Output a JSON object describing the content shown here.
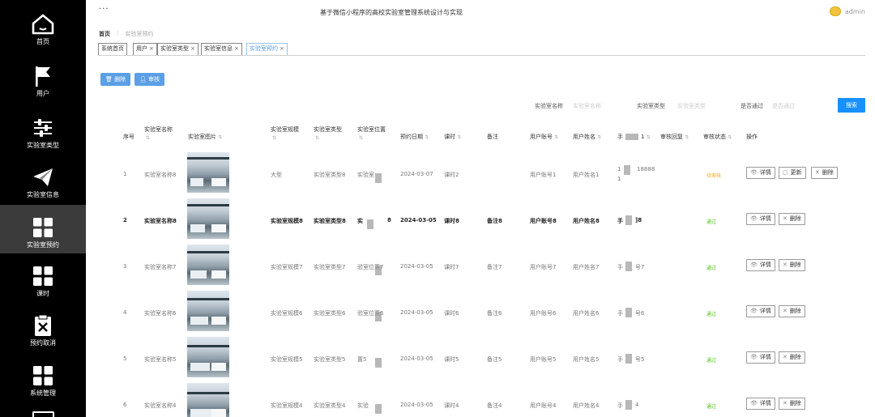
{
  "app": {
    "title": "基于微信小程序的高校实验室管理系统设计与实现",
    "more": "···",
    "user": "admin"
  },
  "sidebar": {
    "items": [
      {
        "label": "首页",
        "icon": "home-icon"
      },
      {
        "label": "用户",
        "icon": "flag-icon"
      },
      {
        "label": "实验室类型",
        "icon": "sliders-icon"
      },
      {
        "label": "实验室信息",
        "icon": "paper-plane-icon"
      },
      {
        "label": "实验室预约",
        "icon": "grid-icon"
      },
      {
        "label": "课时",
        "icon": "grid-icon"
      },
      {
        "label": "预约取消",
        "icon": "clipboard-x-icon"
      },
      {
        "label": "系统管理",
        "icon": "grid-icon"
      }
    ],
    "active_index": 4
  },
  "breadcrumb": {
    "home": "首页",
    "current": "实验室预约"
  },
  "tabs": [
    {
      "label": "系统首页",
      "closable": false
    },
    {
      "label": "用户",
      "closable": true
    },
    {
      "label": "实验室类型",
      "closable": true
    },
    {
      "label": "实验室信息",
      "closable": true
    },
    {
      "label": "实验室预约",
      "closable": true
    }
  ],
  "actions": {
    "delete": "删除",
    "review": "审核"
  },
  "search": {
    "name_label": "实验室名称",
    "name_placeholder": "实验室名称",
    "type_label": "实验室类型",
    "type_placeholder": "实验室类型",
    "pass_label": "是否通过",
    "pass_placeholder": "是否通过",
    "button": "搜索"
  },
  "columns": {
    "index": "序号",
    "name": "实验室名称",
    "image": "实验室图片",
    "scale": "实验室规模",
    "type": "实验室类型",
    "location": "实验室位置",
    "date": "预约日期",
    "lesson": "课时",
    "remark": "备注",
    "account": "用户账号",
    "username": "用户姓名",
    "phone_prefix": "手",
    "phone_suffix": "1",
    "reply": "审核回复",
    "status": "审核状态",
    "ops": "操作"
  },
  "rows": [
    {
      "index": "1",
      "name": "实验室名称8",
      "scale": "大型",
      "type": "实验室类型8",
      "location": "实验室",
      "date": "2024-03-07",
      "lesson": "课时2",
      "remark": "",
      "account": "用户账号1",
      "username": "用户姓名1",
      "phone_a": "1",
      "phone_b": "18888",
      "phone_c": "1",
      "status": "待审核",
      "status_color": "#f5a623",
      "bold": false,
      "can_update": true
    },
    {
      "index": "2",
      "name": "实验室名称8",
      "scale": "实验室规模8",
      "type": "实验室类型8",
      "location": "实",
      "location_b": "8",
      "date": "2024-03-05",
      "lesson": "课时8",
      "remark": "备注8",
      "account": "用户账号8",
      "username": "用户姓名8",
      "phone_a": "手",
      "phone_b": "]8",
      "status": "通过",
      "status_color": "#52c41a",
      "bold": true,
      "can_update": false
    },
    {
      "index": "3",
      "name": "实验室名称7",
      "scale": "实验室规模7",
      "type": "实验室类型7",
      "location": "验室位置7",
      "date": "2024-03-05",
      "lesson": "课时7",
      "remark": "备注7",
      "account": "用户账号7",
      "username": "用户姓名7",
      "phone_a": "手",
      "phone_b": "号7",
      "status": "通过",
      "status_color": "#52c41a",
      "bold": false,
      "can_update": false
    },
    {
      "index": "4",
      "name": "实验室名称6",
      "scale": "实验室规模6",
      "type": "实验室类型6",
      "location": "验室位置6",
      "date": "2024-03-05",
      "lesson": "课时6",
      "remark": "备注6",
      "account": "用户账号6",
      "username": "用户姓名6",
      "phone_a": "手",
      "phone_b": "号6",
      "status": "通过",
      "status_color": "#52c41a",
      "bold": false,
      "can_update": false
    },
    {
      "index": "5",
      "name": "实验室名称5",
      "scale": "实验室规模5",
      "type": "实验室类型5",
      "location": "置5",
      "date": "2024-03-05",
      "lesson": "课时5",
      "remark": "备注5",
      "account": "用户账号5",
      "username": "用户姓名5",
      "phone_a": "手",
      "phone_b": "号5",
      "status": "通过",
      "status_color": "#52c41a",
      "bold": false,
      "can_update": false
    },
    {
      "index": "6",
      "name": "实验室名称4",
      "scale": "实验室规模4",
      "type": "实验室类型4",
      "location": "实验",
      "date": "2024-03-05",
      "lesson": "课时4",
      "remark": "备注4",
      "account": "用户账号4",
      "username": "用户姓名4",
      "phone_a": "手",
      "phone_b": "4",
      "status": "通过",
      "status_color": "#52c41a",
      "bold": false,
      "can_update": false
    }
  ],
  "row_actions": {
    "detail": "详情",
    "update": "更新",
    "delete": "删除"
  },
  "colors": {
    "sidebar_bg": "#000000",
    "sidebar_active": "#3b3b3b",
    "primary": "#1890ff",
    "action_btn": "#5b9fe6"
  }
}
